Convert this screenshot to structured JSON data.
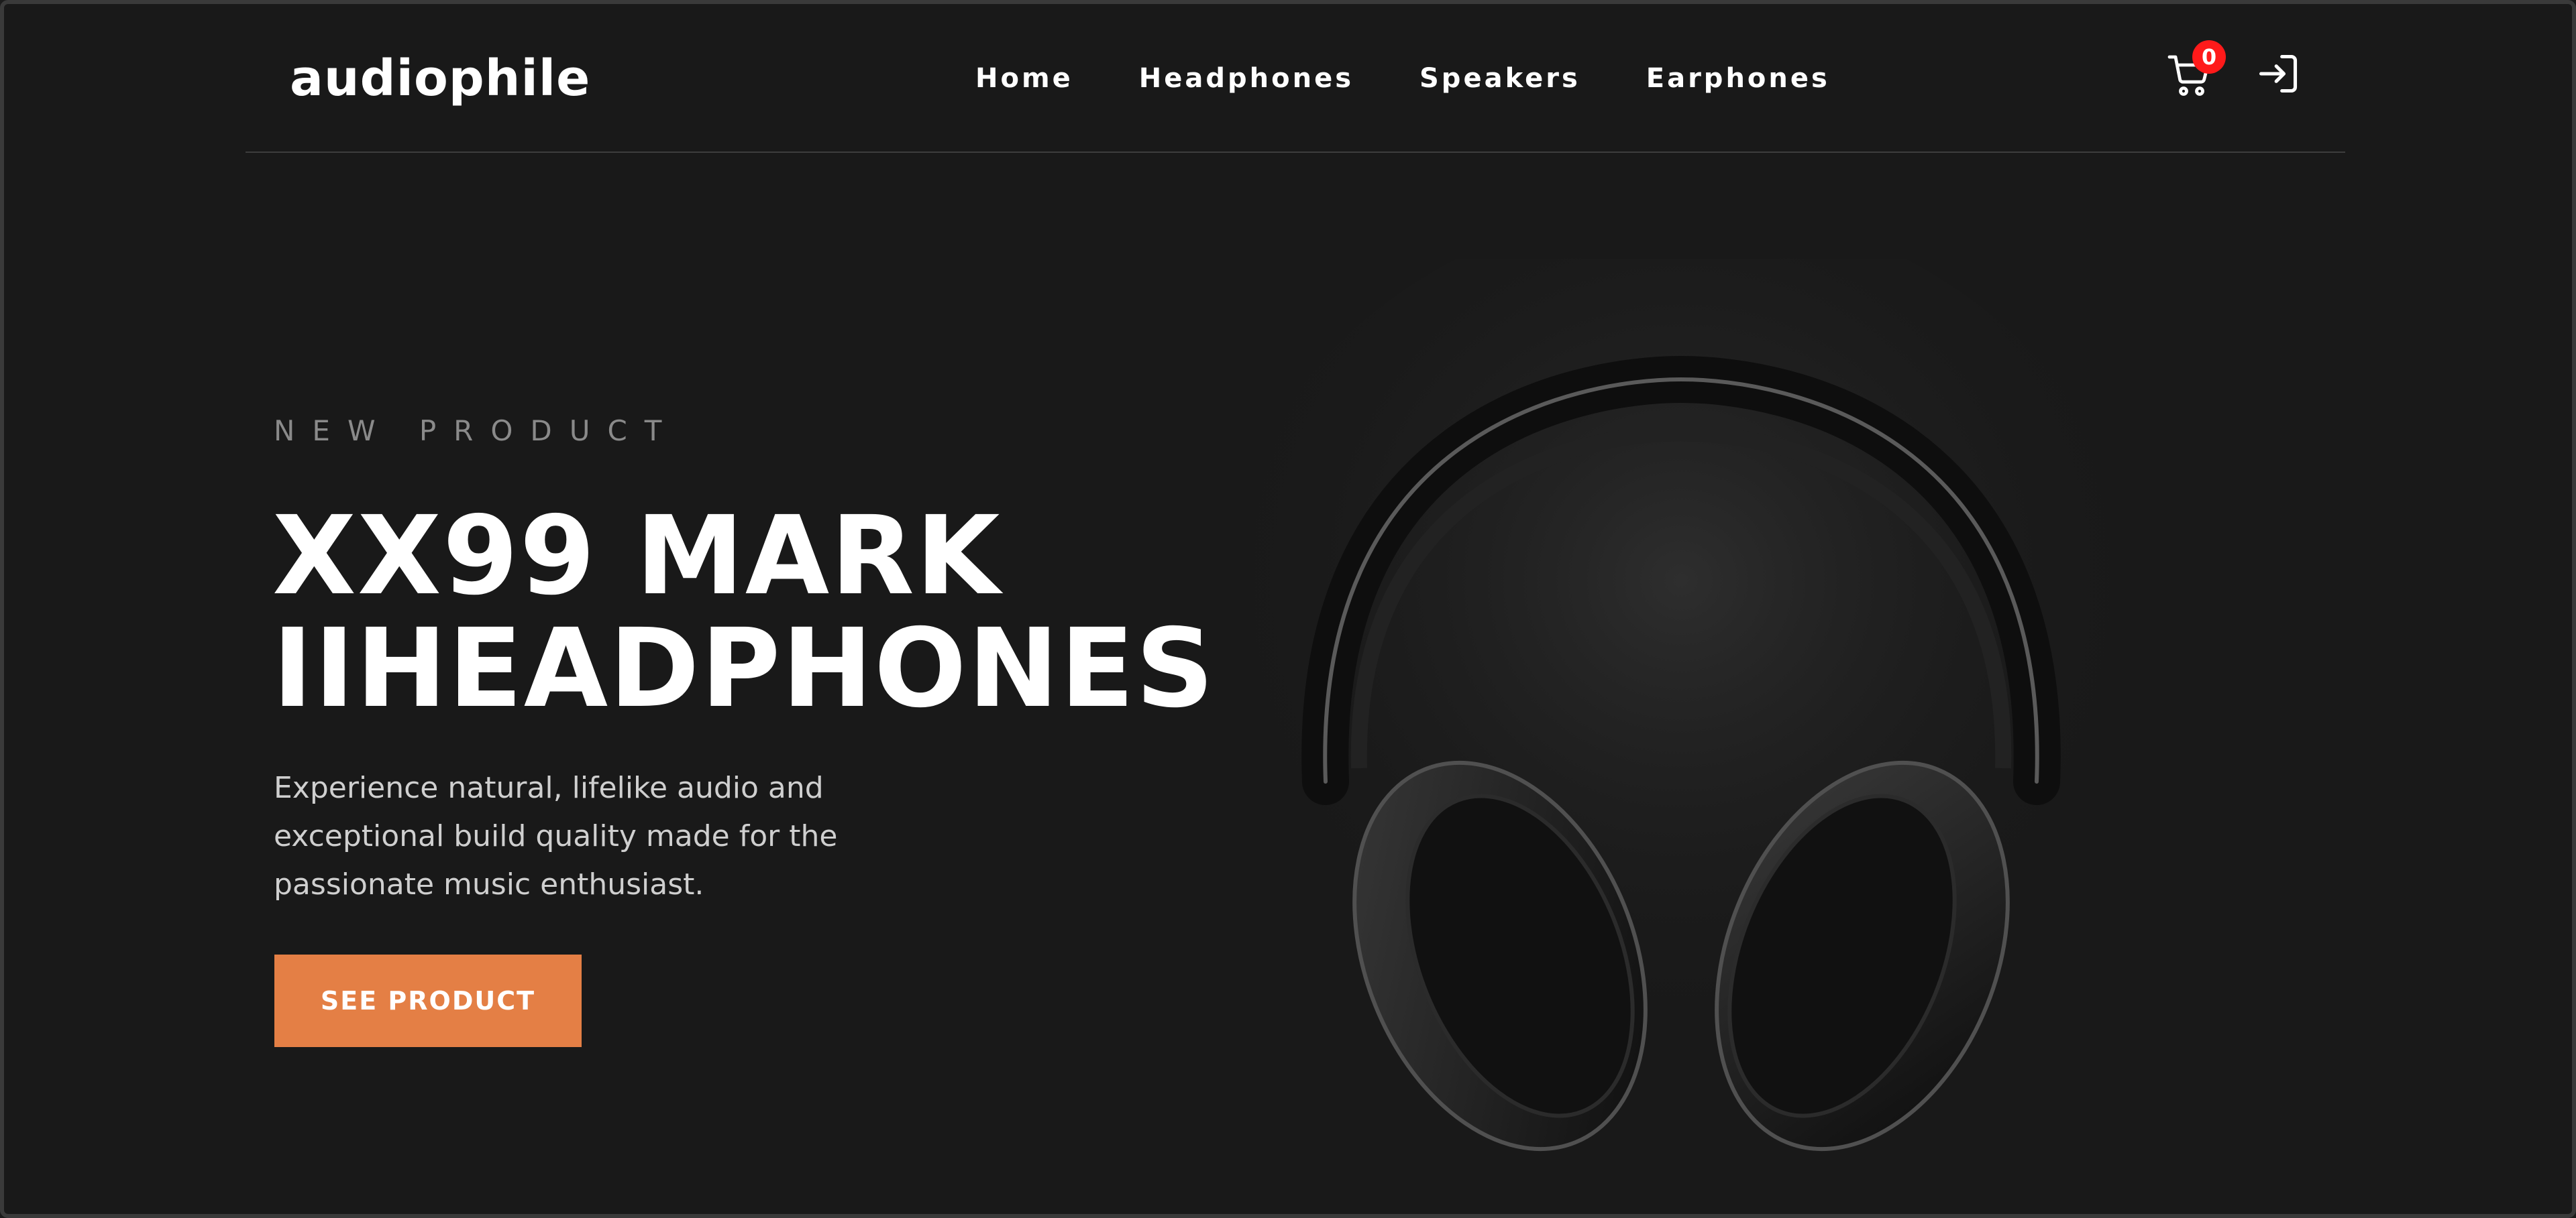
{
  "brand": {
    "logo": "audiophile"
  },
  "nav": {
    "items": [
      {
        "label": "Home"
      },
      {
        "label": "Headphones"
      },
      {
        "label": "Speakers"
      },
      {
        "label": "Earphones"
      }
    ]
  },
  "header": {
    "cart_count": "0",
    "icons": {
      "cart": "cart-icon",
      "login": "login-icon"
    }
  },
  "hero": {
    "eyebrow": "NEW PRODUCT",
    "title_line1": "XX99 MARK",
    "title_line2": "IIHEADPHONES",
    "description": "Experience natural, lifelike audio and exceptional build quality made for the passionate music enthusiast.",
    "cta_label": "SEE PRODUCT",
    "image": "headphones-product-image"
  },
  "colors": {
    "background": "#191919",
    "accent": "#e47f45",
    "badge": "#ff1a1a",
    "text": "#ffffff"
  }
}
